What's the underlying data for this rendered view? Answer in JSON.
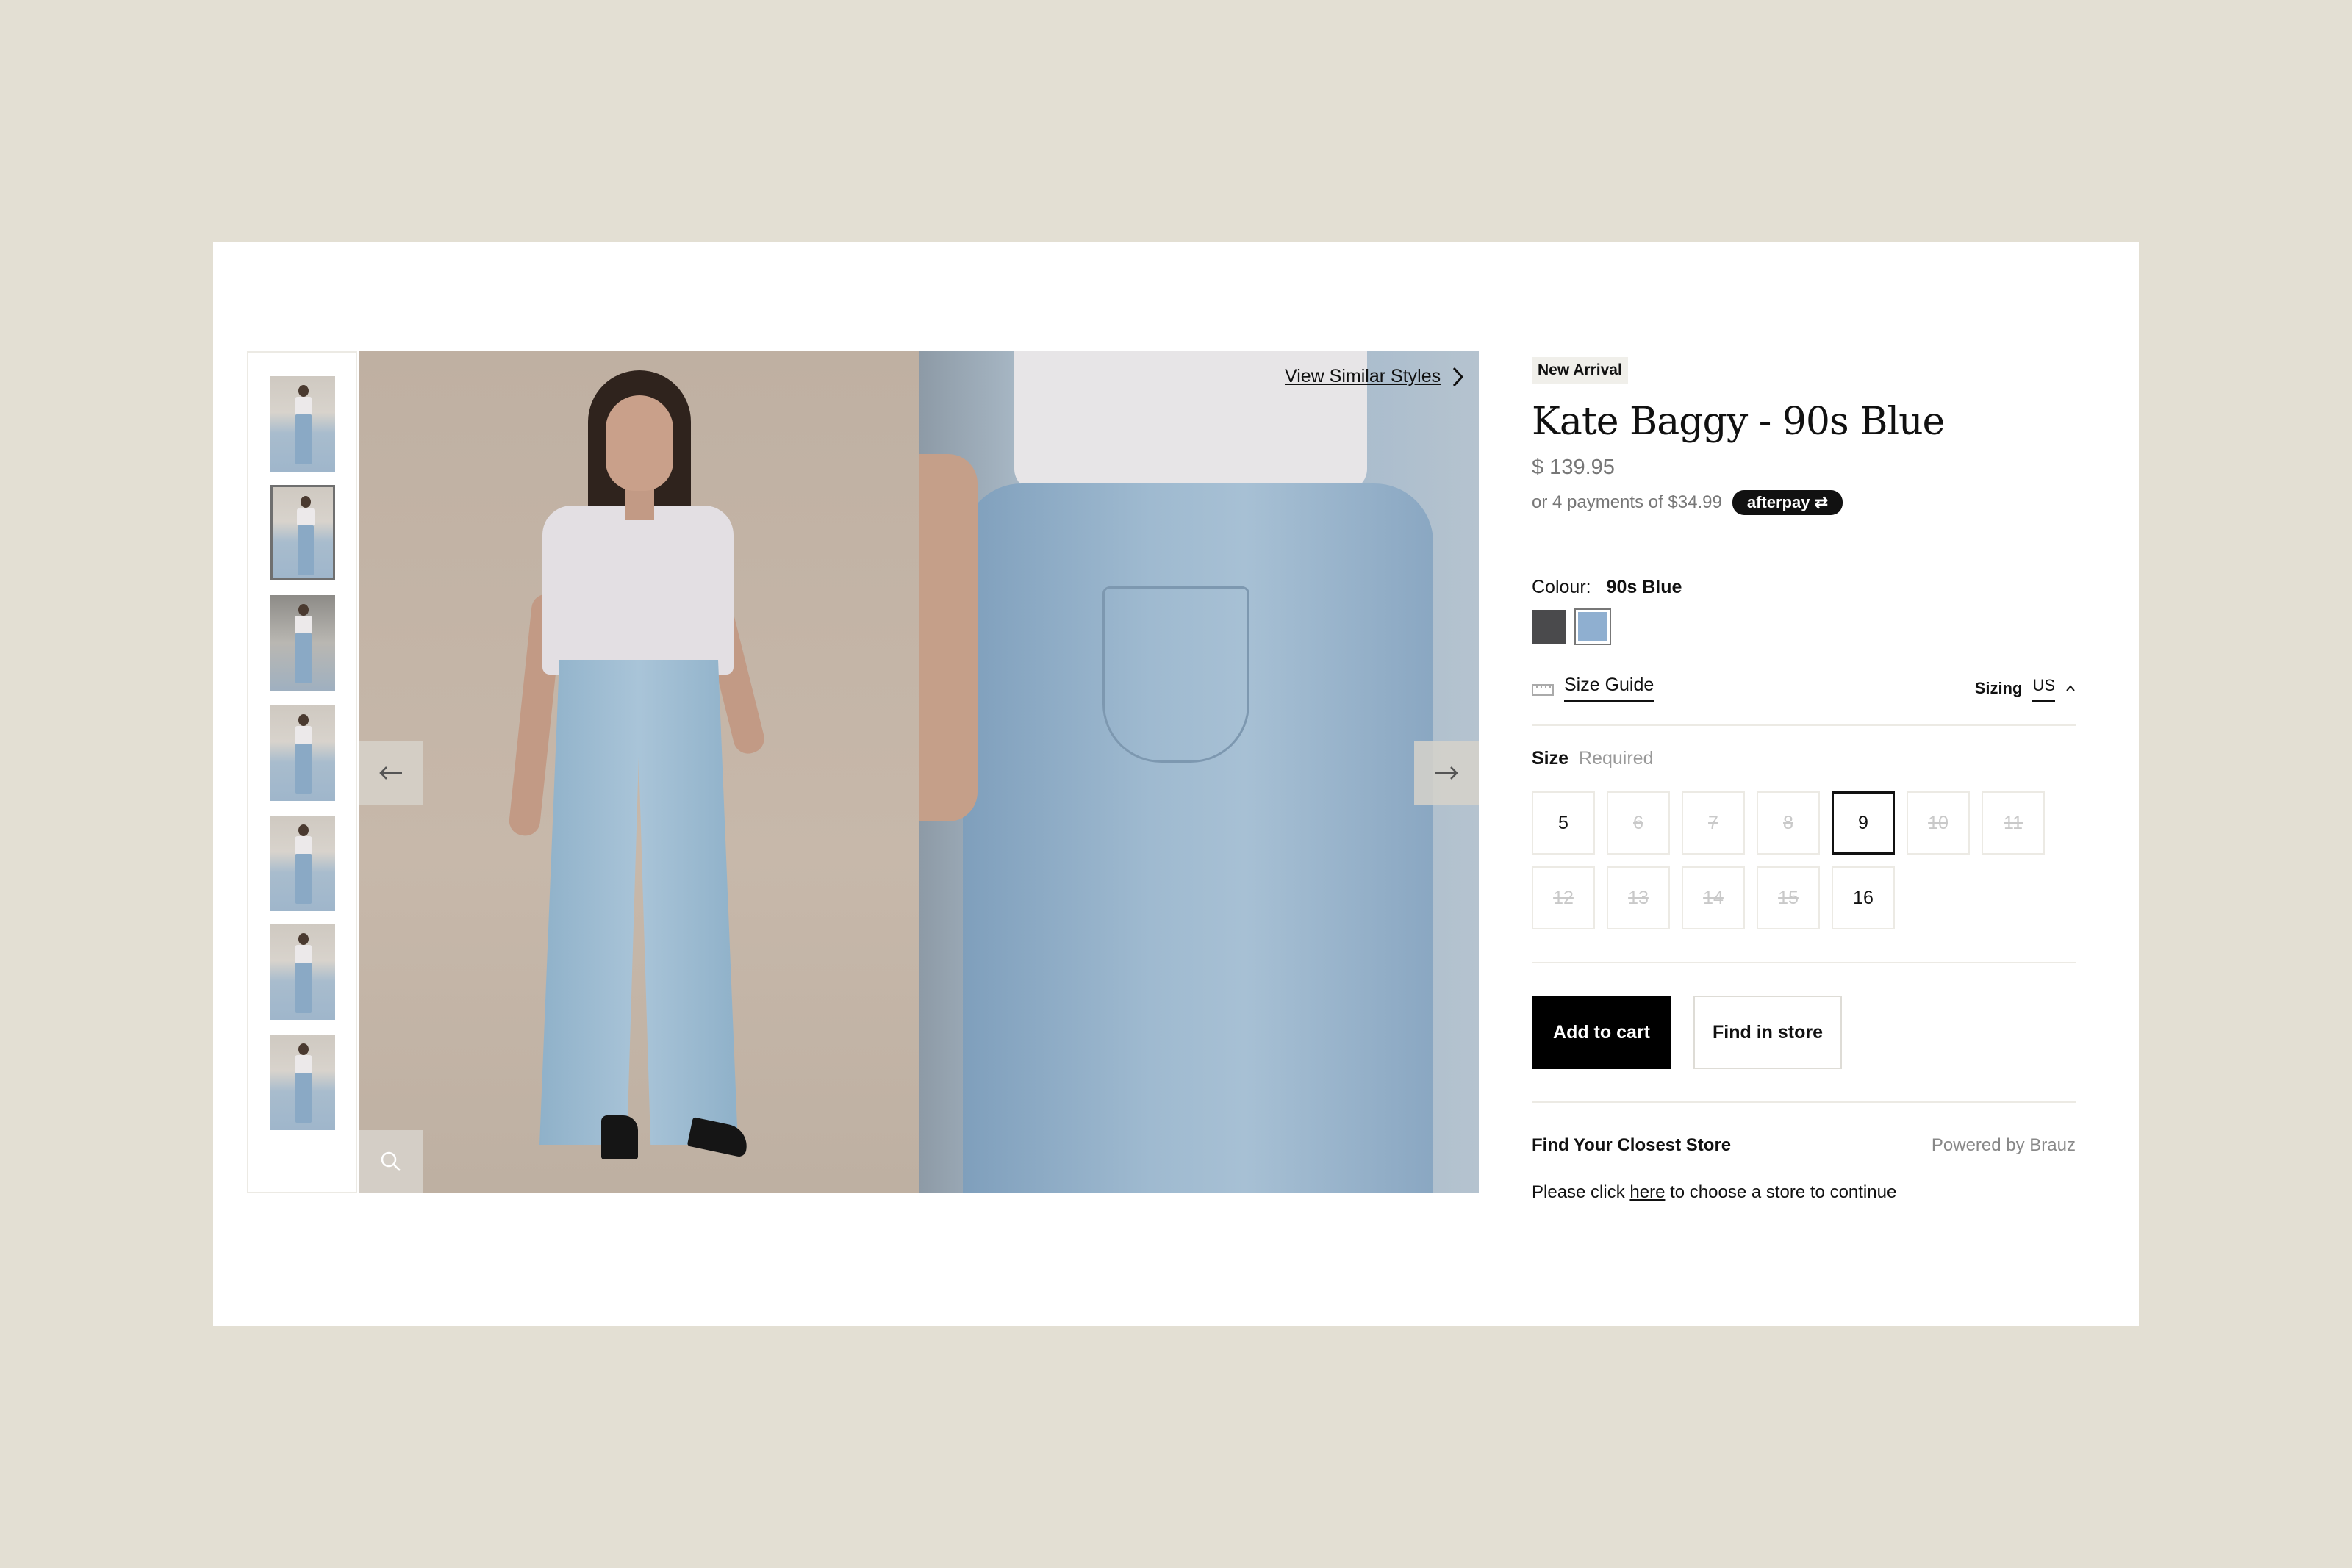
{
  "gallery": {
    "view_similar": "View Similar Styles",
    "thumbnail_count": 7,
    "active_thumbnail": 2
  },
  "product": {
    "badge": "New Arrival",
    "title": "Kate Baggy - 90s Blue",
    "price": "$ 139.95",
    "installments": "or 4 payments of $34.99",
    "afterpay_label": "afterpay"
  },
  "colour": {
    "label": "Colour:",
    "selected": "90s Blue",
    "swatches": [
      {
        "name": "charcoal",
        "color": "#4a4a4c"
      },
      {
        "name": "90s-blue",
        "color": "#8fafd0"
      }
    ]
  },
  "size_guide": {
    "label": "Size Guide",
    "sizing_label": "Sizing",
    "sizing_value": "US"
  },
  "sizes": {
    "label": "Size",
    "required": "Required",
    "options": [
      {
        "label": "5",
        "available": true,
        "selected": false
      },
      {
        "label": "6",
        "available": false,
        "selected": false
      },
      {
        "label": "7",
        "available": false,
        "selected": false
      },
      {
        "label": "8",
        "available": false,
        "selected": false
      },
      {
        "label": "9",
        "available": true,
        "selected": true
      },
      {
        "label": "10",
        "available": false,
        "selected": false
      },
      {
        "label": "11",
        "available": false,
        "selected": false
      },
      {
        "label": "12",
        "available": false,
        "selected": false
      },
      {
        "label": "13",
        "available": false,
        "selected": false
      },
      {
        "label": "14",
        "available": false,
        "selected": false
      },
      {
        "label": "15",
        "available": false,
        "selected": false
      },
      {
        "label": "16",
        "available": true,
        "selected": false
      }
    ]
  },
  "actions": {
    "add_to_cart": "Add to cart",
    "find_in_store": "Find in store"
  },
  "store_finder": {
    "title": "Find Your Closest Store",
    "powered_by": "Powered by Brauz",
    "msg_before": "Please click ",
    "msg_link": "here",
    "msg_after": " to choose a store to continue"
  }
}
